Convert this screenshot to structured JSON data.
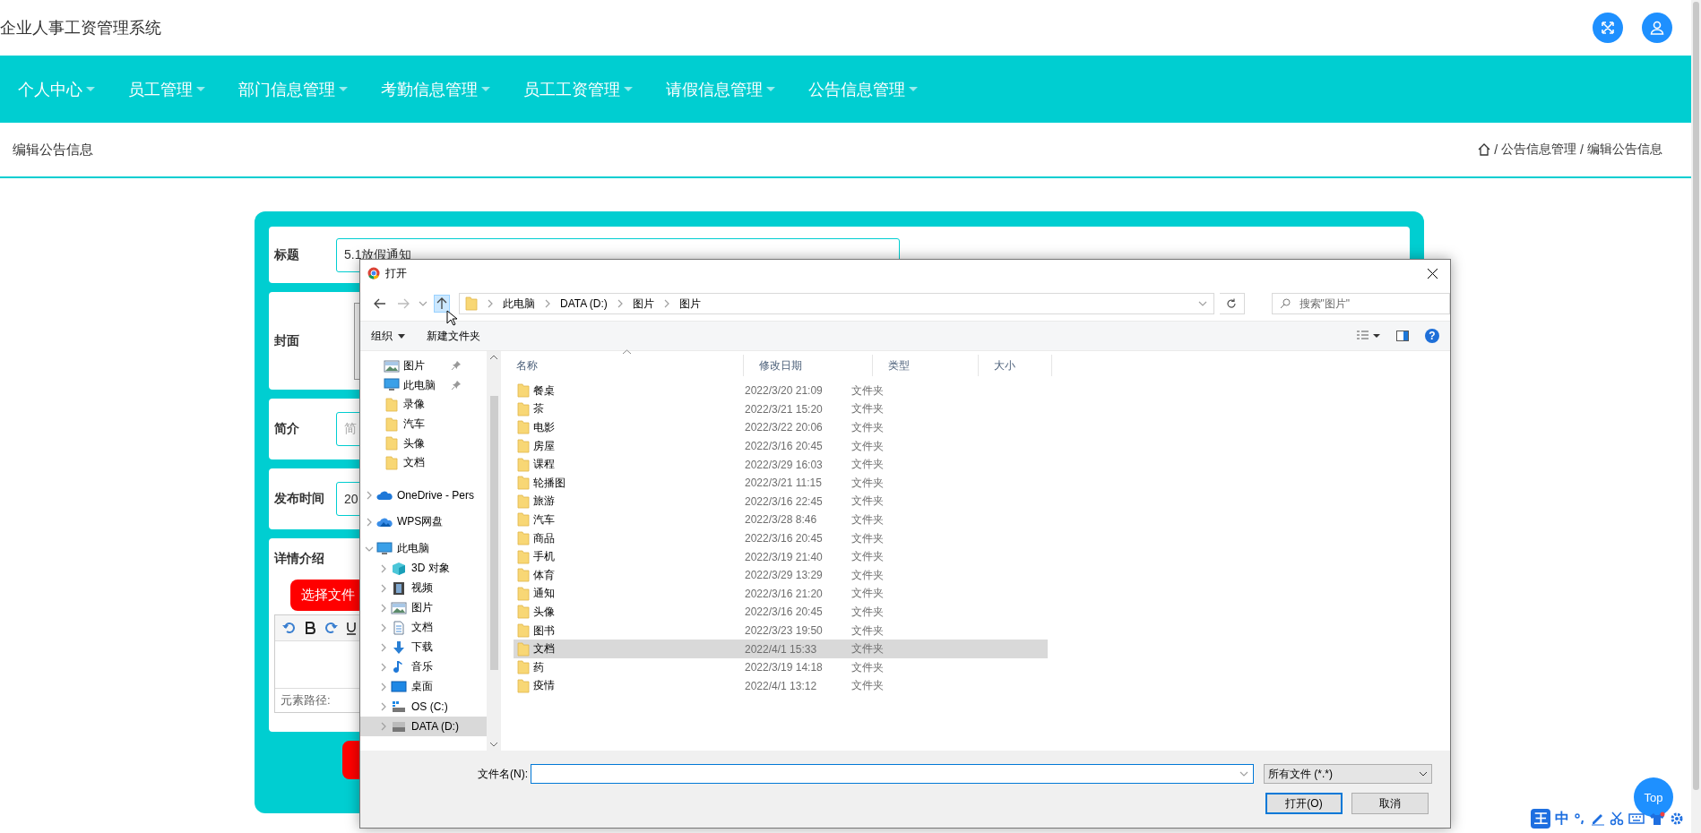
{
  "header": {
    "title": "企业人事工资管理系统"
  },
  "nav": [
    {
      "label": "个人中心"
    },
    {
      "label": "员工管理"
    },
    {
      "label": "部门信息管理"
    },
    {
      "label": "考勤信息管理"
    },
    {
      "label": "员工工资管理"
    },
    {
      "label": "请假信息管理"
    },
    {
      "label": "公告信息管理"
    }
  ],
  "page_header": {
    "title": "编辑公告信息",
    "breadcrumb": [
      {
        "sep": "/",
        "label": "公告信息管理"
      },
      {
        "sep": "/",
        "label": "编辑公告信息"
      }
    ]
  },
  "form": {
    "fields": [
      {
        "kind": "text",
        "label": "标题",
        "value": "5.1放假通知"
      },
      {
        "kind": "image",
        "label": "封面"
      },
      {
        "kind": "text",
        "label": "简介",
        "placeholder": "简"
      },
      {
        "kind": "text",
        "label": "发布时间",
        "value": "20"
      },
      {
        "kind": "editor",
        "label": "详情介绍",
        "button": "选择文件",
        "status": "元素路径:"
      }
    ]
  },
  "dialog": {
    "title": "打开",
    "address": [
      "此电脑",
      "DATA (D:)",
      "图片",
      "图片"
    ],
    "search_placeholder": "搜索\"图片\"",
    "toolbar": {
      "organize": "组织",
      "new_folder": "新建文件夹",
      "help": "?"
    },
    "quick_access": [
      {
        "kind": "picture",
        "label": "图片",
        "pinned": true
      },
      {
        "kind": "pc",
        "label": "此电脑",
        "pinned": true
      },
      {
        "kind": "folder",
        "label": "录像",
        "pinned": false
      },
      {
        "kind": "folder",
        "label": "汽车",
        "pinned": false
      },
      {
        "kind": "folder",
        "label": "头像",
        "pinned": false
      },
      {
        "kind": "folder",
        "label": "文档",
        "pinned": false
      }
    ],
    "tree": [
      {
        "kind": "onedrive",
        "label": "OneDrive - Pers",
        "expanded": false,
        "selected": false
      },
      {
        "kind": "wps",
        "label": "WPS网盘",
        "expanded": false,
        "selected": false
      },
      {
        "kind": "pc",
        "label": "此电脑",
        "expanded": true,
        "selected": false,
        "children": [
          {
            "kind": "cube",
            "label": "3D 对象",
            "expanded": false,
            "selected": false
          },
          {
            "kind": "video",
            "label": "视频",
            "expanded": false,
            "selected": false
          },
          {
            "kind": "picture",
            "label": "图片",
            "expanded": false,
            "selected": false
          },
          {
            "kind": "document",
            "label": "文档",
            "expanded": false,
            "selected": false
          },
          {
            "kind": "download",
            "label": "下载",
            "expanded": false,
            "selected": false
          },
          {
            "kind": "music",
            "label": "音乐",
            "expanded": false,
            "selected": false
          },
          {
            "kind": "desktop",
            "label": "桌面",
            "expanded": false,
            "selected": false
          },
          {
            "kind": "drive_c",
            "label": "OS (C:)",
            "expanded": false,
            "selected": false
          },
          {
            "kind": "drive",
            "label": "DATA (D:)",
            "expanded": false,
            "selected": true
          }
        ]
      }
    ],
    "columns": [
      "名称",
      "修改日期",
      "类型",
      "大小"
    ],
    "files": [
      {
        "name": "餐桌",
        "modified": "2022/3/20 21:09",
        "type": "文件夹",
        "selected": false
      },
      {
        "name": "茶",
        "modified": "2022/3/21 15:20",
        "type": "文件夹",
        "selected": false
      },
      {
        "name": "电影",
        "modified": "2022/3/22 20:06",
        "type": "文件夹",
        "selected": false
      },
      {
        "name": "房屋",
        "modified": "2022/3/16 20:45",
        "type": "文件夹",
        "selected": false
      },
      {
        "name": "课程",
        "modified": "2022/3/29 16:03",
        "type": "文件夹",
        "selected": false
      },
      {
        "name": "轮播图",
        "modified": "2022/3/21 11:15",
        "type": "文件夹",
        "selected": false
      },
      {
        "name": "旅游",
        "modified": "2022/3/16 22:45",
        "type": "文件夹",
        "selected": false
      },
      {
        "name": "汽车",
        "modified": "2022/3/28 8:46",
        "type": "文件夹",
        "selected": false
      },
      {
        "name": "商品",
        "modified": "2022/3/16 20:45",
        "type": "文件夹",
        "selected": false
      },
      {
        "name": "手机",
        "modified": "2022/3/19 21:40",
        "type": "文件夹",
        "selected": false
      },
      {
        "name": "体育",
        "modified": "2022/3/29 13:29",
        "type": "文件夹",
        "selected": false
      },
      {
        "name": "通知",
        "modified": "2022/3/16 21:20",
        "type": "文件夹",
        "selected": false
      },
      {
        "name": "头像",
        "modified": "2022/3/16 20:45",
        "type": "文件夹",
        "selected": false
      },
      {
        "name": "图书",
        "modified": "2022/3/23 19:50",
        "type": "文件夹",
        "selected": false
      },
      {
        "name": "文档",
        "modified": "2022/4/1 15:33",
        "type": "文件夹",
        "selected": true
      },
      {
        "name": "药",
        "modified": "2022/3/19 14:18",
        "type": "文件夹",
        "selected": false
      },
      {
        "name": "疫情",
        "modified": "2022/4/1 13:12",
        "type": "文件夹",
        "selected": false
      }
    ],
    "filename_label": "文件名(N):",
    "filter": "所有文件 (*.*)",
    "buttons": [
      {
        "label": "打开(O)",
        "default": true
      },
      {
        "label": "取消",
        "default": false
      }
    ]
  },
  "back_to_top": "Top",
  "ime": {
    "logo": "王",
    "mode": "中"
  }
}
